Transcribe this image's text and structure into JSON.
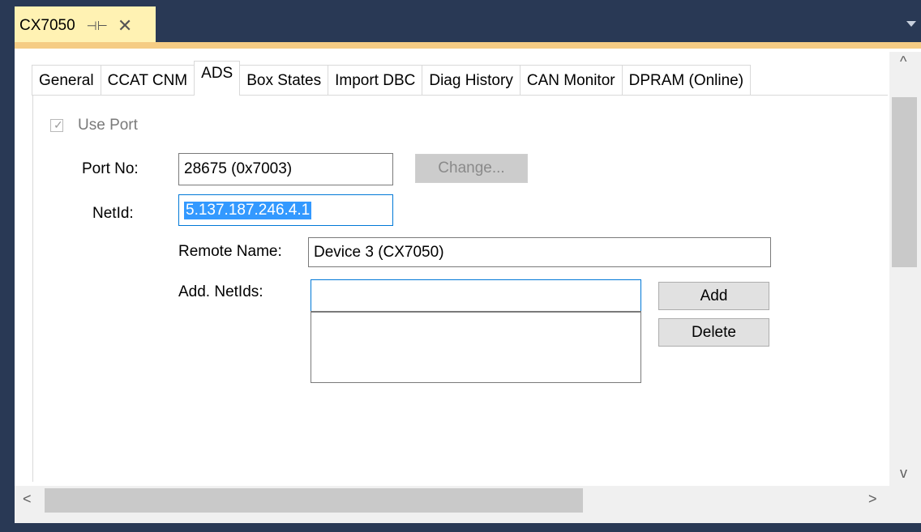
{
  "window": {
    "tab_title": "CX7050",
    "pin_icon": "pin-icon",
    "close_icon": "close-icon"
  },
  "tabs": [
    {
      "label": "General",
      "active": false
    },
    {
      "label": "CCAT CNM",
      "active": false
    },
    {
      "label": "ADS",
      "active": true
    },
    {
      "label": "Box States",
      "active": false
    },
    {
      "label": "Import DBC",
      "active": false
    },
    {
      "label": "Diag History",
      "active": false
    },
    {
      "label": "CAN Monitor",
      "active": false
    },
    {
      "label": "DPRAM (Online)",
      "active": false
    }
  ],
  "ads": {
    "use_port": {
      "label": "Use Port",
      "checked": true,
      "enabled": false
    },
    "port_no": {
      "label": "Port No:",
      "value": "28675 (0x7003)"
    },
    "change_button": {
      "label": "Change...",
      "enabled": false
    },
    "netid": {
      "label": "NetId:",
      "value": "5.137.187.246.4.1"
    },
    "remote_name": {
      "label": "Remote Name:",
      "value": "Device 3 (CX7050)"
    },
    "add_netids": {
      "label": "Add. NetIds:",
      "value": "",
      "items": []
    },
    "add_button": {
      "label": "Add"
    },
    "delete_button": {
      "label": "Delete"
    }
  },
  "scrollbars": {
    "up_arrow": "^",
    "down_arrow": "v",
    "left_arrow": "<",
    "right_arrow": ">"
  },
  "colors": {
    "frame": "#293955",
    "active_doc_tab": "#fff2b3",
    "selection": "#3399ff",
    "focus_border": "#0078d7"
  }
}
